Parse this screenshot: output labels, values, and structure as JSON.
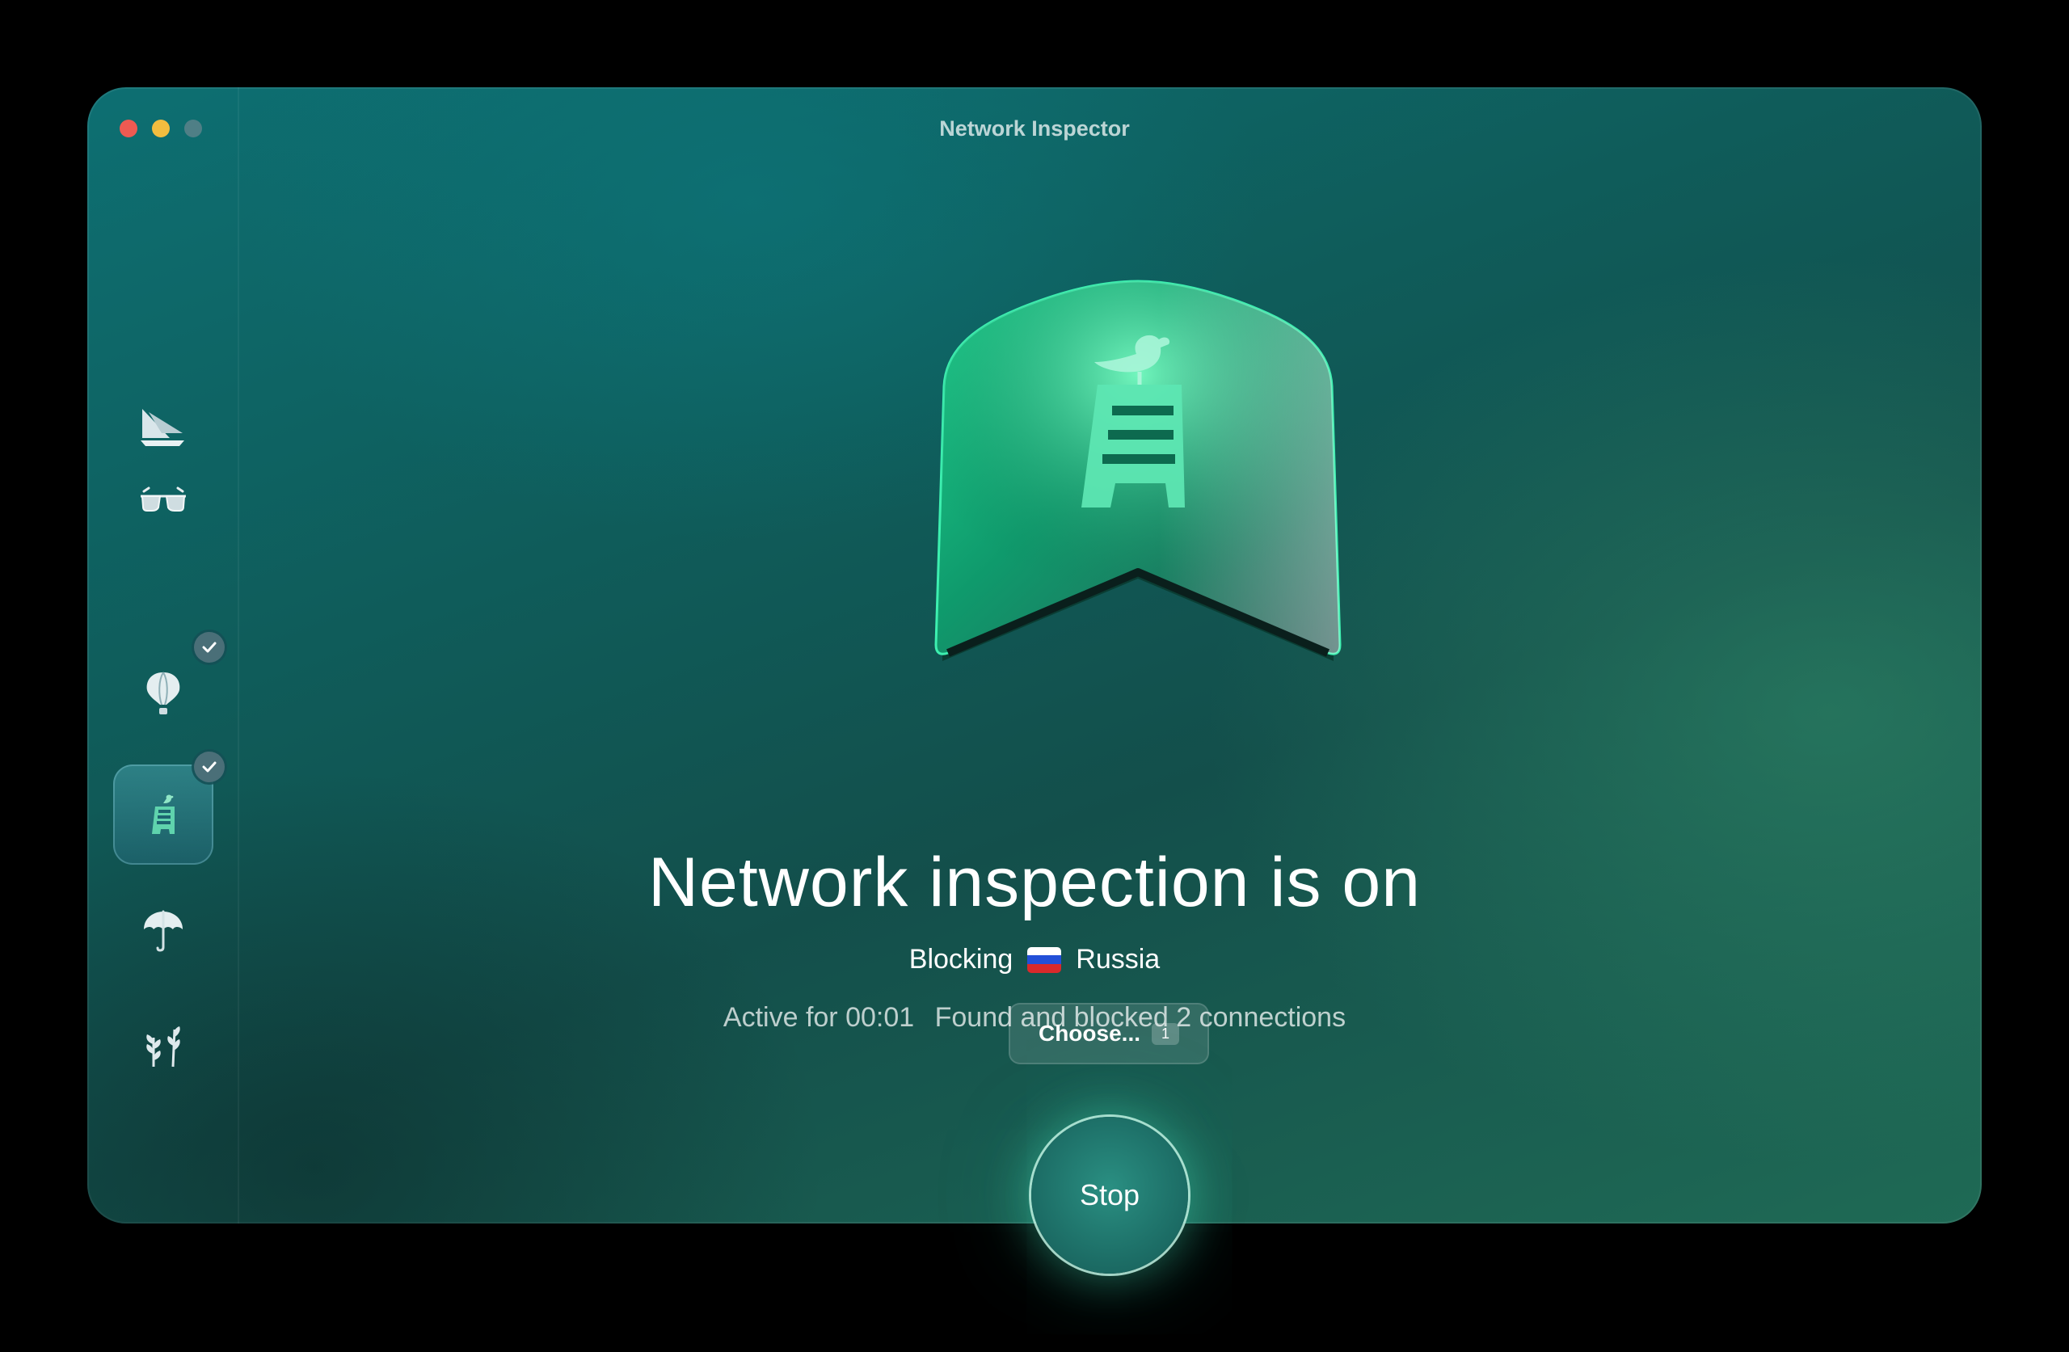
{
  "window": {
    "title": "Network Inspector"
  },
  "sidebar": {
    "items": [
      {
        "icon": "sailboat-icon",
        "checked": false,
        "active": false
      },
      {
        "icon": "glasses-icon",
        "checked": false,
        "active": false
      },
      {
        "icon": "hot-air-balloon-icon",
        "checked": true,
        "active": false
      },
      {
        "icon": "ladder-bird-icon",
        "checked": true,
        "active": true
      },
      {
        "icon": "umbrella-icon",
        "checked": false,
        "active": false
      },
      {
        "icon": "plants-icon",
        "checked": false,
        "active": false
      }
    ]
  },
  "main": {
    "headline": "Network inspection is on",
    "blocking_label": "Blocking",
    "country": "Russia",
    "country_flag": "russia-flag-icon",
    "active_label": "Active for 00:01",
    "blocked_label": "Found and blocked 2 connections",
    "choose_label": "Choose...",
    "choose_count": "1",
    "stop_label": "Stop"
  },
  "colors": {
    "accent": "#3fe0a8",
    "background_start": "#0d6f72",
    "background_end": "#1f6a55",
    "close": "#ee5a52",
    "minimize": "#f2bd3f"
  }
}
